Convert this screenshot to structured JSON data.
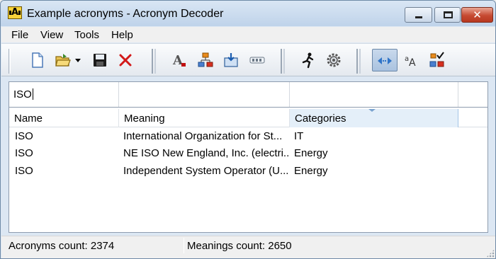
{
  "window": {
    "title": "Example acronyms - Acronym Decoder",
    "app_icon_letter": "A"
  },
  "menu": {
    "items": [
      "File",
      "View",
      "Tools",
      "Help"
    ]
  },
  "toolbar": {
    "groups": [
      [
        "new-document-icon",
        "open-folder-icon",
        "dropdown-arrow-icon",
        "save-icon",
        "delete-icon"
      ],
      [
        "font-format-icon",
        "hierarchy-icon",
        "import-icon",
        "tag-icon"
      ],
      [
        "run-icon",
        "settings-gear-icon"
      ],
      [
        "view-toggle-icon",
        "text-size-icon",
        "categories-icon"
      ]
    ],
    "pressed": "view-toggle-icon"
  },
  "filter": {
    "name_value": "ISO",
    "meaning_value": "",
    "categories_value": ""
  },
  "table": {
    "columns": [
      "Name",
      "Meaning",
      "Categories"
    ],
    "sorted_column": "Categories",
    "rows": [
      {
        "name": "ISO",
        "meaning": "International Organization for St...",
        "categories": "IT"
      },
      {
        "name": "ISO",
        "meaning": "NE ISO New England, Inc. (electri...",
        "categories": "Energy"
      },
      {
        "name": "ISO",
        "meaning": "Independent System Operator (U...",
        "categories": "Energy"
      }
    ]
  },
  "status": {
    "acronyms": "Acronyms count: 2374",
    "meanings": "Meanings count: 2650"
  },
  "colors": {
    "titlebar": "#c4d6ea",
    "close_button": "#c64a32",
    "sorted_header": "#e4eff9",
    "list_background": "#ffffff"
  }
}
